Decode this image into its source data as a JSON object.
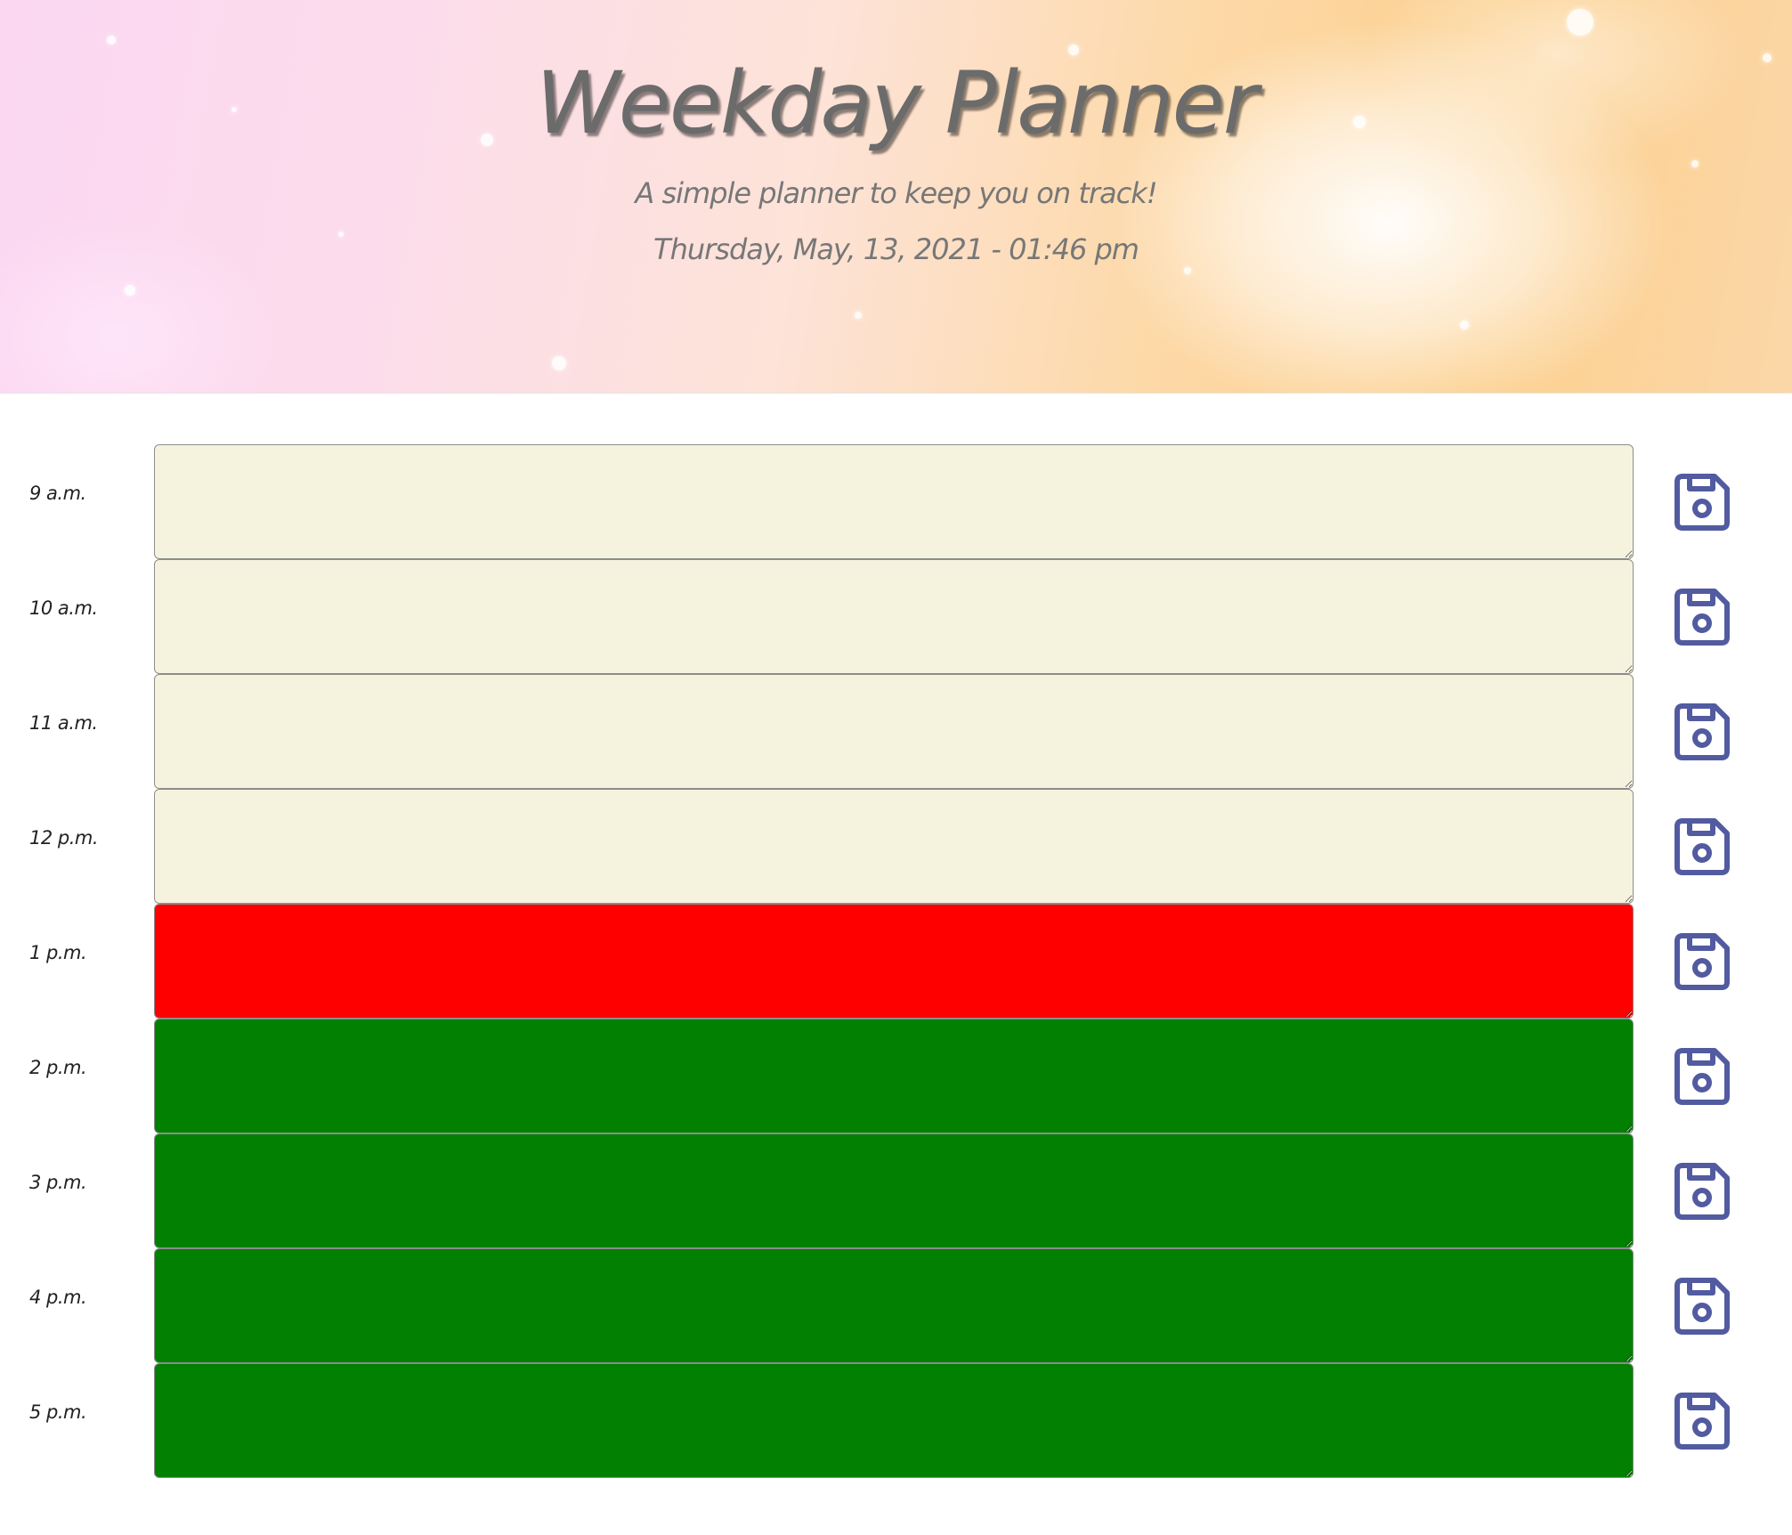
{
  "header": {
    "title": "Weekday Planner",
    "subtitle": "A simple planner to keep you on track!",
    "datetime": "Thursday, May, 13, 2021 - 01:46 pm"
  },
  "colors": {
    "past": "#f5f3de",
    "present": "#ff0000",
    "future": "#018001",
    "save_icon": "#525ba0"
  },
  "time_blocks": [
    {
      "hour": "9 a.m.",
      "text": "",
      "status": "past"
    },
    {
      "hour": "10 a.m.",
      "text": "",
      "status": "past"
    },
    {
      "hour": "11 a.m.",
      "text": "",
      "status": "past"
    },
    {
      "hour": "12 p.m.",
      "text": "",
      "status": "past"
    },
    {
      "hour": "1 p.m.",
      "text": "",
      "status": "present"
    },
    {
      "hour": "2 p.m.",
      "text": "",
      "status": "future"
    },
    {
      "hour": "3 p.m.",
      "text": "",
      "status": "future"
    },
    {
      "hour": "4 p.m.",
      "text": "",
      "status": "future"
    },
    {
      "hour": "5 p.m.",
      "text": "",
      "status": "future"
    }
  ],
  "icons": {
    "save": "floppy-disk-icon"
  }
}
